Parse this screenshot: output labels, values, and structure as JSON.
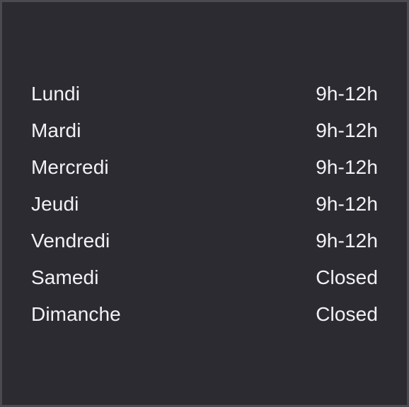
{
  "schedule": [
    {
      "day": "Lundi",
      "hours": "9h-12h"
    },
    {
      "day": "Mardi",
      "hours": "9h-12h"
    },
    {
      "day": "Mercredi",
      "hours": "9h-12h"
    },
    {
      "day": "Jeudi",
      "hours": "9h-12h"
    },
    {
      "day": "Vendredi",
      "hours": "9h-12h"
    },
    {
      "day": "Samedi",
      "hours": "Closed"
    },
    {
      "day": "Dimanche",
      "hours": "Closed"
    }
  ],
  "colors": {
    "background": "#2c2b31",
    "frame": "#4a4a50",
    "text": "#f2f2f5"
  }
}
